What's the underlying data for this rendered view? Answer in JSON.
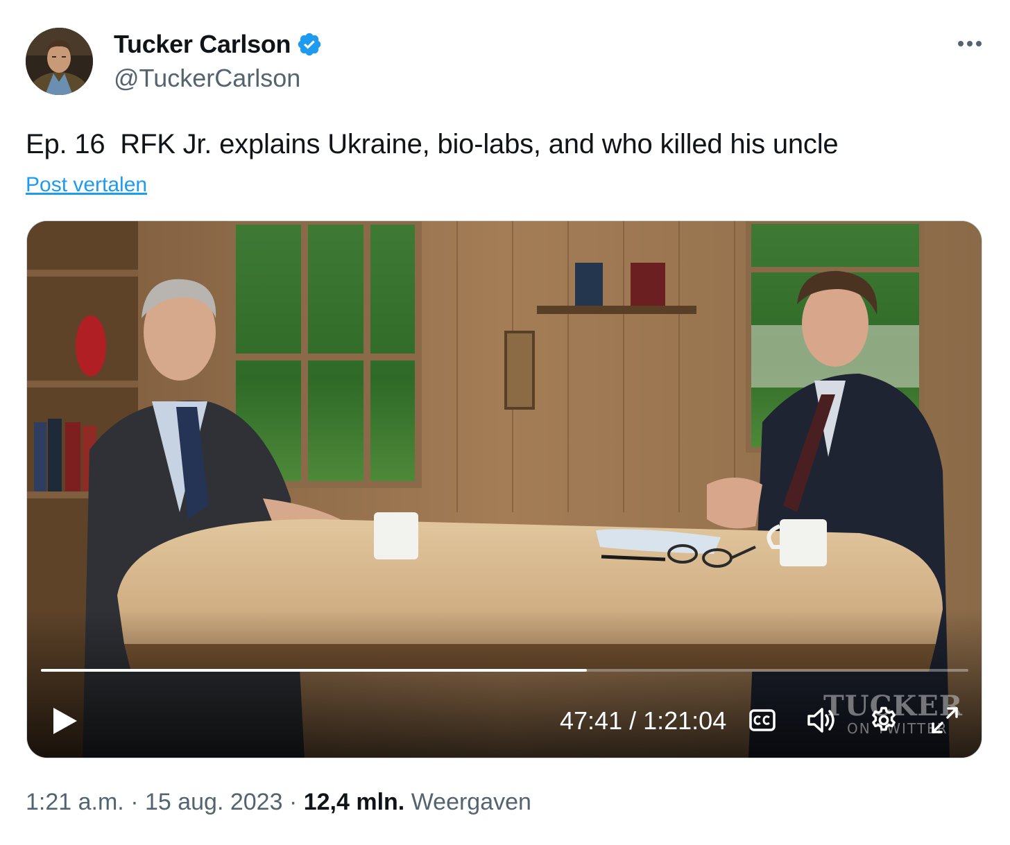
{
  "author": {
    "display_name": "Tucker Carlson",
    "handle": "@TuckerCarlson",
    "verified": true,
    "verified_color": "#1d9bf0"
  },
  "tweet": {
    "text": "Ep. 16  RFK Jr. explains Ukraine, bio-labs, and who killed his uncle",
    "translate_link": "Post vertalen"
  },
  "video": {
    "current_time": "47:41",
    "separator": " / ",
    "duration": "1:21:04",
    "progress": 0.5884,
    "watermark_main": "TUCKER",
    "watermark_sub": "ON TWITTER"
  },
  "meta": {
    "time": "1:21 a.m.",
    "dot": " · ",
    "date": "15 aug. 2023",
    "views_count": "12,4 mln.",
    "views_label": "Weergaven"
  },
  "colors": {
    "text_primary": "#0f1419",
    "text_secondary": "#536471",
    "link": "#1d9bf0"
  },
  "icons": [
    "avatar",
    "verified-badge-icon",
    "more-options-icon",
    "play-icon",
    "closed-captions-icon",
    "volume-icon",
    "settings-gear-icon",
    "fullscreen-icon"
  ]
}
